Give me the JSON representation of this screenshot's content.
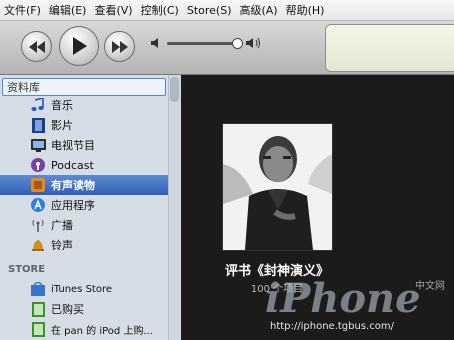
{
  "menu": [
    "文件(F)",
    "编辑(E)",
    "查看(V)",
    "控制(C)",
    "Store(S)",
    "高级(A)",
    "帮助(H)"
  ],
  "volume_level": 0.96,
  "sidebar": {
    "section_library": "资料库",
    "library_items": [
      {
        "label": "音乐",
        "icon": "music-note-icon"
      },
      {
        "label": "影片",
        "icon": "film-icon"
      },
      {
        "label": "电视节目",
        "icon": "tv-icon"
      },
      {
        "label": "Podcast",
        "icon": "podcast-icon"
      },
      {
        "label": "有声读物",
        "icon": "audiobook-icon",
        "selected": true
      },
      {
        "label": "应用程序",
        "icon": "app-store-icon"
      },
      {
        "label": "广播",
        "icon": "radio-antenna-icon"
      },
      {
        "label": "铃声",
        "icon": "bell-icon"
      }
    ],
    "section_store": "STORE",
    "store_items": [
      {
        "label": "iTunes Store",
        "icon": "itunes-store-icon"
      },
      {
        "label": "已购买",
        "icon": "purchased-icon"
      },
      {
        "label": "在 pan 的 iPod 上购...",
        "icon": "ipod-purchased-icon"
      }
    ]
  },
  "album": {
    "title": "评书《封神演义》",
    "count": "100 个项目"
  },
  "watermark": {
    "logo": "iPhone",
    "url": "http://iphone.tgbus.com/",
    "badge": "中文网"
  }
}
